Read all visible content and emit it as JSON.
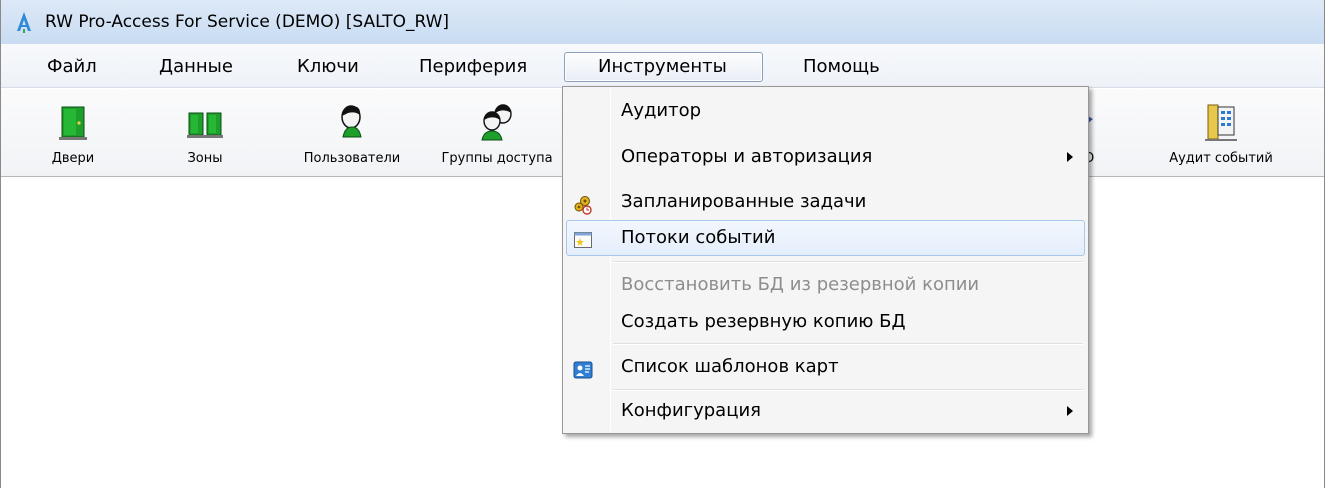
{
  "window": {
    "title": "RW Pro-Access For Service (DEMO) [SALTO_RW]"
  },
  "menubar": {
    "items": [
      {
        "label": "Файл"
      },
      {
        "label": "Данные"
      },
      {
        "label": "Ключи"
      },
      {
        "label": "Периферия"
      },
      {
        "label": "Инструменты",
        "active": true
      },
      {
        "label": "Помощь"
      }
    ]
  },
  "toolbar": {
    "items": [
      {
        "label": "Двери",
        "icon": "door-icon"
      },
      {
        "label": "Зоны",
        "icon": "zones-icon"
      },
      {
        "label": "Пользователи",
        "icon": "user-icon"
      },
      {
        "label": "Группы доступа",
        "icon": "user-group-icon"
      },
      {
        "label": "О",
        "icon": "key-icon"
      },
      {
        "label": "Аудит событий",
        "icon": "audit-icon"
      }
    ]
  },
  "tools_menu": {
    "items": [
      {
        "label": "Аудитор",
        "icon": null
      },
      {
        "label": "Операторы и авторизация",
        "submenu": true
      },
      {
        "label": "Запланированные задачи",
        "icon": "gears-clock-icon"
      },
      {
        "label": "Потоки событий",
        "icon": "event-stream-icon",
        "highlighted": true
      },
      {
        "label": "Восстановить БД из резервной копии",
        "disabled": true
      },
      {
        "label": "Создать резервную копию БД"
      },
      {
        "label": "Список шаблонов карт",
        "icon": "card-template-icon"
      },
      {
        "label": "Конфигурация",
        "submenu": true
      }
    ]
  },
  "colors": {
    "titlebar": "#c9dcf2",
    "menu_highlight_border": "#a8c8ec",
    "disabled_text": "#8d8d8d"
  }
}
